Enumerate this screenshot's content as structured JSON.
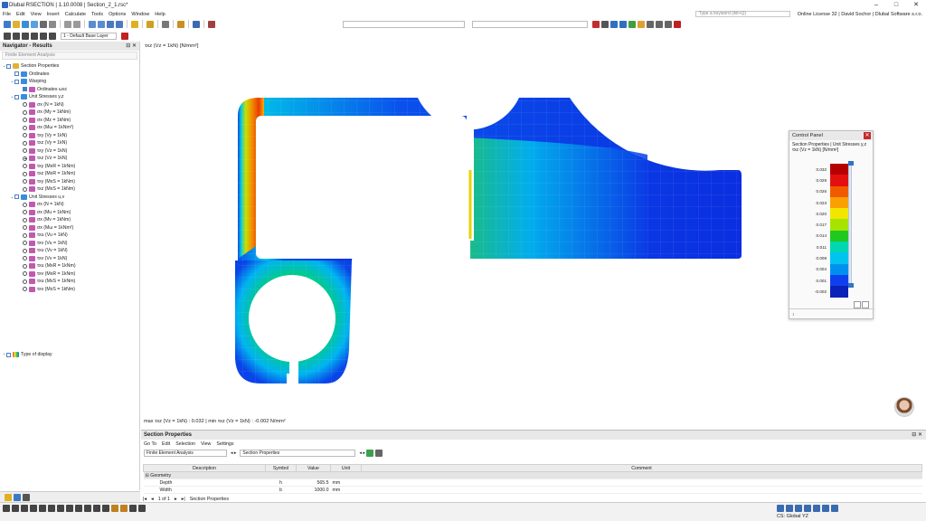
{
  "window": {
    "title": "Dlubal RSECTION | 1.10.0008 | Section_2_1.rsc*",
    "license": "Online License 32 | David Sochor | Dlubal Software s.r.o."
  },
  "menu": [
    "File",
    "Edit",
    "View",
    "Insert",
    "Calculate",
    "Tools",
    "Options",
    "Window",
    "Help"
  ],
  "search": {
    "placeholder": "Type a keyword (Alt+Q)"
  },
  "toolbar": {
    "layer_label": "1 - Default Base Layer"
  },
  "navigator": {
    "title": "Navigator - Results",
    "subtitle": "Finite Element Analysis",
    "type_of_display": "Type of display",
    "items": [
      {
        "label": "Section Properties",
        "kind": "folder"
      },
      {
        "label": "Ordinates",
        "kind": "check"
      },
      {
        "label": "Warping",
        "kind": "check"
      },
      {
        "label": "Ordinates ωsc",
        "kind": "icon"
      },
      {
        "label": "Unit Stresses y,z",
        "kind": "check"
      },
      {
        "label": "σx (N = 1kN)",
        "kind": "radio"
      },
      {
        "label": "σx (My = 1kNm)",
        "kind": "radio"
      },
      {
        "label": "σx (Mz = 1kNm)",
        "kind": "radio"
      },
      {
        "label": "σx (Mω = 1kNm²)",
        "kind": "radio"
      },
      {
        "label": "τxy (Vy = 1kN)",
        "kind": "radio"
      },
      {
        "label": "τxz (Vy = 1kN)",
        "kind": "radio"
      },
      {
        "label": "τxy (Vz = 1kN)",
        "kind": "radio"
      },
      {
        "label": "τxz (Vz = 1kN)",
        "kind": "radio",
        "selected": true
      },
      {
        "label": "τxy (MxR = 1kNm)",
        "kind": "radio"
      },
      {
        "label": "τxz (MxR = 1kNm)",
        "kind": "radio"
      },
      {
        "label": "τxy (MxS = 1kNm)",
        "kind": "radio"
      },
      {
        "label": "τxz (MxS = 1kNm)",
        "kind": "radio"
      },
      {
        "label": "Unit Stresses u,v",
        "kind": "check"
      },
      {
        "label": "σx (N = 1kN)",
        "kind": "radio"
      },
      {
        "label": "σx (Mu = 1kNm)",
        "kind": "radio"
      },
      {
        "label": "σx (Mv = 1kNm)",
        "kind": "radio"
      },
      {
        "label": "σx (Mω = 1kNm²)",
        "kind": "radio"
      },
      {
        "label": "τxu (Vu = 1kN)",
        "kind": "radio"
      },
      {
        "label": "τxv (Vu = 1kN)",
        "kind": "radio"
      },
      {
        "label": "τxu (Vv = 1kN)",
        "kind": "radio"
      },
      {
        "label": "τxv (Vv = 1kN)",
        "kind": "radio"
      },
      {
        "label": "τxu (MxR = 1kNm)",
        "kind": "radio"
      },
      {
        "label": "τxv (MxR = 1kNm)",
        "kind": "radio"
      },
      {
        "label": "τxu (MxS = 1kNm)",
        "kind": "radio"
      },
      {
        "label": "τxv (MxS = 1kNm)",
        "kind": "radio"
      }
    ]
  },
  "viewport": {
    "title": "τxz (Vz = 1kN) [N/mm²]",
    "footer": "max τxz (Vz = 1kN) : 0.032 | min τxz (Vz = 1kN) : -0.002 N/mm²"
  },
  "control_panel": {
    "title": "Control Panel",
    "subtitle": "Section Properties | Unit Stresses y,z",
    "subtitle2": "τxz (Vz = 1kN) [N/mm²]",
    "legend": [
      {
        "value": "0.032",
        "color": "#b50000"
      },
      {
        "value": "0.029",
        "color": "#e41010"
      },
      {
        "value": "0.026",
        "color": "#f25a00"
      },
      {
        "value": "0.023",
        "color": "#f9a100"
      },
      {
        "value": "0.020",
        "color": "#f2e600"
      },
      {
        "value": "0.017",
        "color": "#a6e400"
      },
      {
        "value": "0.014",
        "color": "#1fc91f"
      },
      {
        "value": "0.011",
        "color": "#00d6b0"
      },
      {
        "value": "0.008",
        "color": "#00c4ee"
      },
      {
        "value": "0.004",
        "color": "#0090f0"
      },
      {
        "value": "0.001",
        "color": "#1040ee"
      },
      {
        "value": "-0.002",
        "color": "#0a22b8"
      }
    ]
  },
  "section_properties": {
    "title": "Section Properties",
    "menu": [
      "Go To",
      "Edit",
      "Selection",
      "View",
      "Settings"
    ],
    "combo_left": "Finite Element Analysis",
    "combo_right": "Section Properties",
    "columns": [
      "Description",
      "Symbol",
      "Value",
      "Unit",
      "Comment"
    ],
    "group": "Geometry",
    "rows": [
      {
        "description": "Depth",
        "symbol": "h",
        "value": "565.5",
        "unit": "mm"
      },
      {
        "description": "Width",
        "symbol": "b",
        "value": "1000.0",
        "unit": "mm"
      }
    ],
    "pager": "1 of 1",
    "tab": "Section Properties"
  },
  "status": {
    "cs": "CS: Global YZ"
  }
}
